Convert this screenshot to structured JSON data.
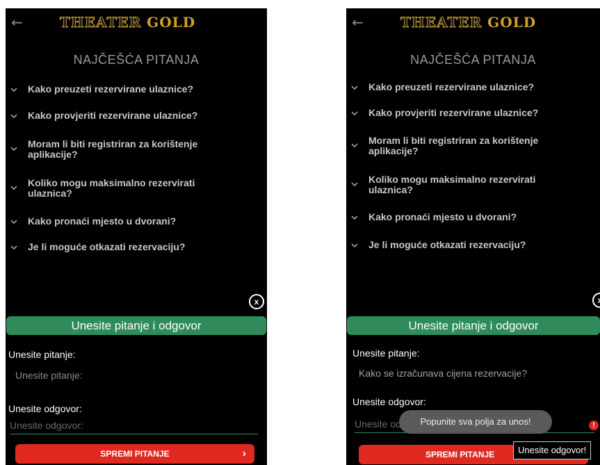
{
  "app": {
    "logo_part1": "THEATER",
    "logo_part2": "GOLD",
    "back_icon": "←"
  },
  "faq": {
    "title": "NAJČEŠĆA PITANJA",
    "items": [
      "Kako preuzeti rezervirane ulaznice?",
      "Kako provjeriti rezervirane ulaznice?",
      "Moram li biti registriran za korištenje aplikacije?",
      "Koliko mogu maksimalno rezervirati ulaznica?",
      "Kako pronaći mjesto u dvorani?",
      "Je li moguće otkazati rezervaciju?"
    ]
  },
  "form": {
    "close_label": "x",
    "header": "Unesite pitanje i odgovor",
    "question_label": "Unesite pitanje:",
    "question_placeholder": "Unesite pitanje:",
    "answer_label": "Unesite odgovor:",
    "answer_placeholder": "Unesite odgovor:",
    "save_button": "SPREMI PITANJE",
    "save_chevron": "›"
  },
  "right_screen": {
    "question_value": "Kako se izračunava cijena rezervacije?",
    "answer_partial": "Unesite od",
    "toast": "Popunite sva polja za unos!",
    "error_icon": "!",
    "error_message": "Unesite odgovor!"
  },
  "colors": {
    "background": "#000000",
    "accent_green": "#2f8b5a",
    "button_red": "#e02a21",
    "logo_gold": "#d3a126"
  }
}
